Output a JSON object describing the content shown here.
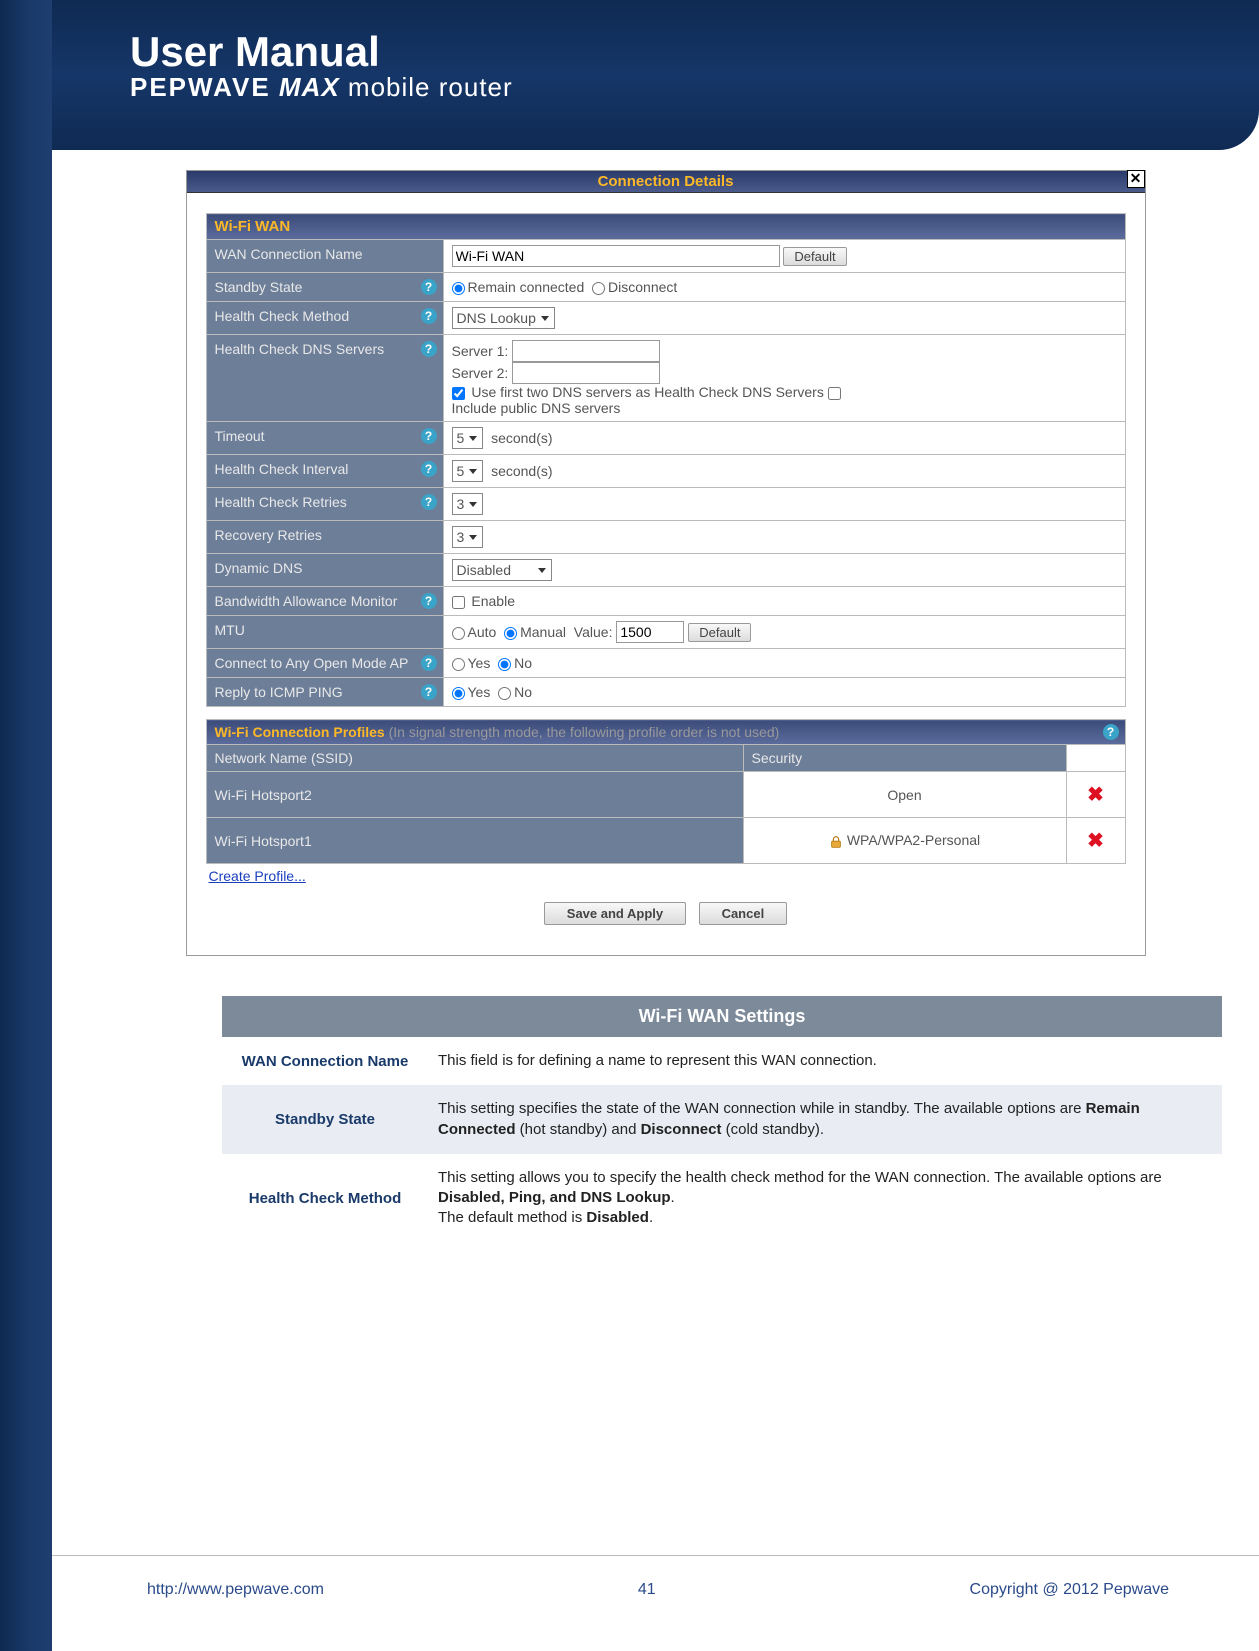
{
  "header": {
    "title": "User Manual",
    "subtitle_brand": "PEPWAVE",
    "subtitle_max": "MAX",
    "subtitle_tail": "mobile router"
  },
  "connection_details": {
    "title": "Connection Details",
    "section_title": "Wi-Fi WAN",
    "rows": {
      "wan_name": {
        "label": "WAN Connection Name",
        "value": "Wi-Fi WAN",
        "default_btn": "Default"
      },
      "standby": {
        "label": "Standby State",
        "opt_remain": "Remain connected",
        "opt_disc": "Disconnect"
      },
      "hc_method": {
        "label": "Health Check Method",
        "value": "DNS Lookup"
      },
      "hc_dns": {
        "label": "Health Check DNS Servers",
        "server1": "Server 1:",
        "server2": "Server 2:",
        "cb1_label": "Use first two DNS servers as Health Check DNS Servers",
        "cb2_label": "Include public DNS servers"
      },
      "timeout": {
        "label": "Timeout",
        "value": "5",
        "unit": "second(s)"
      },
      "hc_interval": {
        "label": "Health Check Interval",
        "value": "5",
        "unit": "second(s)"
      },
      "hc_retries": {
        "label": "Health Check Retries",
        "value": "3"
      },
      "rec_retries": {
        "label": "Recovery Retries",
        "value": "3"
      },
      "ddns": {
        "label": "Dynamic DNS",
        "value": "Disabled"
      },
      "bwm": {
        "label": "Bandwidth Allowance Monitor",
        "enable": "Enable"
      },
      "mtu": {
        "label": "MTU",
        "auto": "Auto",
        "manual": "Manual",
        "value_label": "Value:",
        "value": "1500",
        "default_btn": "Default"
      },
      "openap": {
        "label": "Connect to Any Open Mode AP",
        "yes": "Yes",
        "no": "No"
      },
      "icmp": {
        "label": "Reply to ICMP PING",
        "yes": "Yes",
        "no": "No"
      }
    }
  },
  "profiles": {
    "title": "Wi-Fi Connection Profiles",
    "note": "(In signal strength mode, the following profile order is not used)",
    "col_ssid": "Network Name (SSID)",
    "col_sec": "Security",
    "rows": [
      {
        "ssid": "Wi-Fi Hotsport2",
        "security": "Open",
        "locked": false
      },
      {
        "ssid": "Wi-Fi Hotsport1",
        "security": "WPA/WPA2-Personal",
        "locked": true
      }
    ],
    "create_link": "Create Profile..."
  },
  "actions": {
    "save": "Save and Apply",
    "cancel": "Cancel"
  },
  "doc": {
    "title": "Wi-Fi WAN Settings",
    "rows": [
      {
        "label": "WAN Connection Name",
        "desc_html": "This field is for defining a name to represent this WAN connection."
      },
      {
        "label": "Standby State",
        "desc_html": "This setting specifies the state of the WAN connection while in standby.  The available options are <b>Remain Connected</b> (hot standby) and <b>Disconnect</b> (cold standby)."
      },
      {
        "label": "Health Check Method",
        "desc_html": "This setting allows you to specify the health check method for the WAN connection.  The available options are <b>Disabled, Ping, and DNS Lookup</b>.<br>The default method is <b>Disabled</b>."
      }
    ]
  },
  "footer": {
    "url": "http://www.pepwave.com",
    "page": "41",
    "copyright": "Copyright @ 2012 Pepwave"
  }
}
